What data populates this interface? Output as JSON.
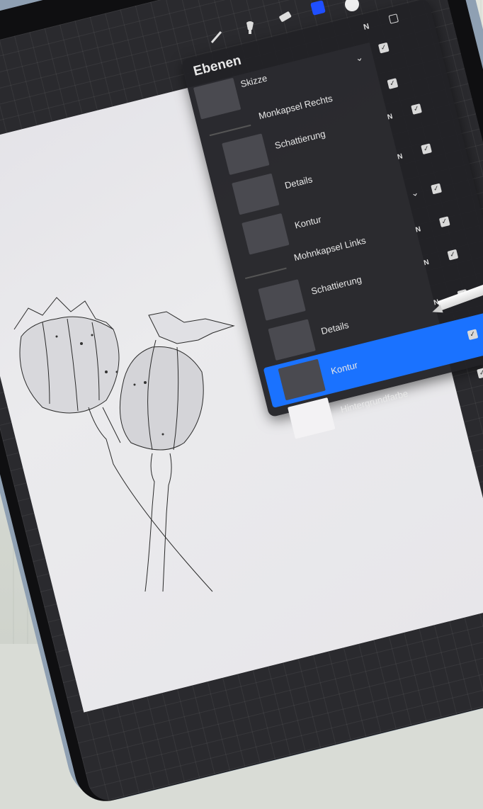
{
  "panel": {
    "title": "Ebenen",
    "header_mode": "N"
  },
  "layers": [
    {
      "name": "Skizze",
      "mode": "",
      "checked": true,
      "type": "layer"
    },
    {
      "name": "Monkapsel Rechts",
      "mode": "",
      "checked": true,
      "type": "group"
    },
    {
      "name": "Schattierung",
      "mode": "N",
      "checked": true,
      "type": "layer"
    },
    {
      "name": "Details",
      "mode": "N",
      "checked": true,
      "type": "layer"
    },
    {
      "name": "Kontur",
      "mode": "N",
      "checked": true,
      "type": "layer"
    },
    {
      "name": "Mohnkapsel Links",
      "mode": "",
      "checked": true,
      "type": "group"
    },
    {
      "name": "Schattierung",
      "mode": "N",
      "checked": true,
      "type": "layer"
    },
    {
      "name": "Details",
      "mode": "N",
      "checked": true,
      "type": "layer"
    },
    {
      "name": "Kontur",
      "mode": "N",
      "checked": true,
      "type": "layer",
      "active": true
    },
    {
      "name": "Hintergrundfarbe",
      "mode": "",
      "checked": true,
      "type": "background"
    }
  ],
  "colors": {
    "accent": "#1a72ff",
    "active_color_swatch": "#1f4fff",
    "panel_bg": "#222226",
    "case": "#8fa0b3"
  },
  "icons": {
    "brush": "brush-icon",
    "smudge": "smudge-icon",
    "eraser": "eraser-icon",
    "add": "plus-icon"
  }
}
